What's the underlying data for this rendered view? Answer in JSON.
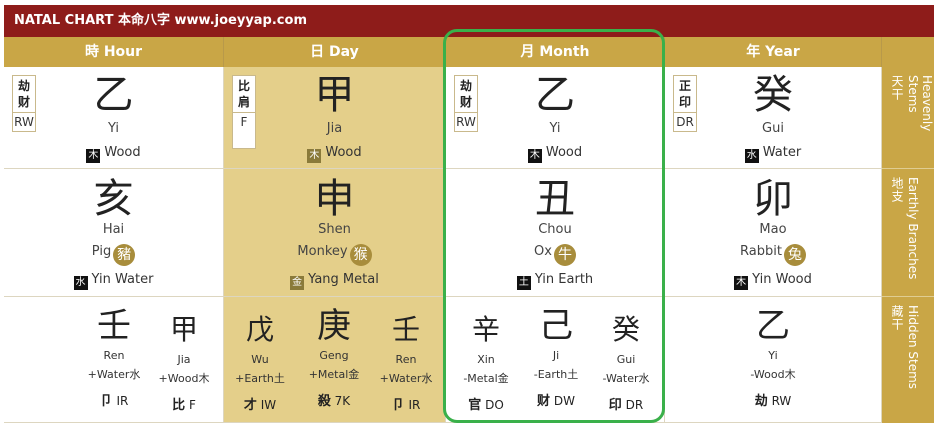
{
  "title": {
    "label": "NATAL CHART 本命八字",
    "url": "www.joeyyap.com"
  },
  "columns": [
    {
      "label": "時 Hour"
    },
    {
      "label": "日 Day"
    },
    {
      "label": "月 Month"
    },
    {
      "label": "年 Year"
    }
  ],
  "side": {
    "stems": {
      "cn": "天干",
      "en": "Heavenly Stems"
    },
    "branches": {
      "cn": "地支",
      "en": "Earthly Branches"
    },
    "hidden": {
      "cn": "藏干",
      "en": "Hidden Stems"
    }
  },
  "stems": [
    {
      "char": "乙",
      "pinyin": "Yi",
      "elem_char": "木",
      "elem": "Wood",
      "god_c1": "劫",
      "god_c2": "财",
      "god_abbr": "RW"
    },
    {
      "char": "甲",
      "pinyin": "Jia",
      "elem_char": "木",
      "elem": "Wood",
      "god_c1": "比",
      "god_c2": "肩",
      "god_abbr": "F"
    },
    {
      "char": "乙",
      "pinyin": "Yi",
      "elem_char": "木",
      "elem": "Wood",
      "god_c1": "劫",
      "god_c2": "财",
      "god_abbr": "RW"
    },
    {
      "char": "癸",
      "pinyin": "Gui",
      "elem_char": "水",
      "elem": "Water",
      "god_c1": "正",
      "god_c2": "印",
      "god_abbr": "DR"
    }
  ],
  "branches": [
    {
      "char": "亥",
      "pinyin": "Hai",
      "animal": "Pig",
      "animal_char": "豬",
      "elem_char": "水",
      "elem": "Yin Water"
    },
    {
      "char": "申",
      "pinyin": "Shen",
      "animal": "Monkey",
      "animal_char": "猴",
      "elem_char": "金",
      "elem": "Yang Metal"
    },
    {
      "char": "丑",
      "pinyin": "Chou",
      "animal": "Ox",
      "animal_char": "牛",
      "elem_char": "土",
      "elem": "Yin Earth"
    },
    {
      "char": "卯",
      "pinyin": "Mao",
      "animal": "Rabbit",
      "animal_char": "兔",
      "elem_char": "木",
      "elem": "Yin Wood"
    }
  ],
  "hidden": {
    "hour": [
      {
        "char": "壬",
        "pinyin": "Ren",
        "elem": "+Water水",
        "god_c": "卩",
        "god_abbr": "IR"
      },
      {
        "char": "甲",
        "pinyin": "Jia",
        "elem": "+Wood木",
        "god_c": "比",
        "god_abbr": "F"
      }
    ],
    "day": [
      {
        "char": "戊",
        "pinyin": "Wu",
        "elem": "+Earth土",
        "god_c": "才",
        "god_abbr": "IW"
      },
      {
        "char": "庚",
        "pinyin": "Geng",
        "elem": "+Metal金",
        "god_c": "殺",
        "god_abbr": "7K"
      },
      {
        "char": "壬",
        "pinyin": "Ren",
        "elem": "+Water水",
        "god_c": "卩",
        "god_abbr": "IR"
      }
    ],
    "month": [
      {
        "char": "辛",
        "pinyin": "Xin",
        "elem": "-Metal金",
        "god_c": "官",
        "god_abbr": "DO"
      },
      {
        "char": "己",
        "pinyin": "Ji",
        "elem": "-Earth土",
        "god_c": "财",
        "god_abbr": "DW"
      },
      {
        "char": "癸",
        "pinyin": "Gui",
        "elem": "-Water水",
        "god_c": "印",
        "god_abbr": "DR"
      }
    ],
    "year": [
      {
        "char": "乙",
        "pinyin": "Yi",
        "elem": "-Wood木",
        "god_c": "劫",
        "god_abbr": "RW"
      }
    ]
  },
  "colors": {
    "title_bg": "#8e1c1a",
    "header_bg": "#c9a646",
    "day_bg": "#e4cf8a",
    "highlight": "#3ab04a"
  }
}
